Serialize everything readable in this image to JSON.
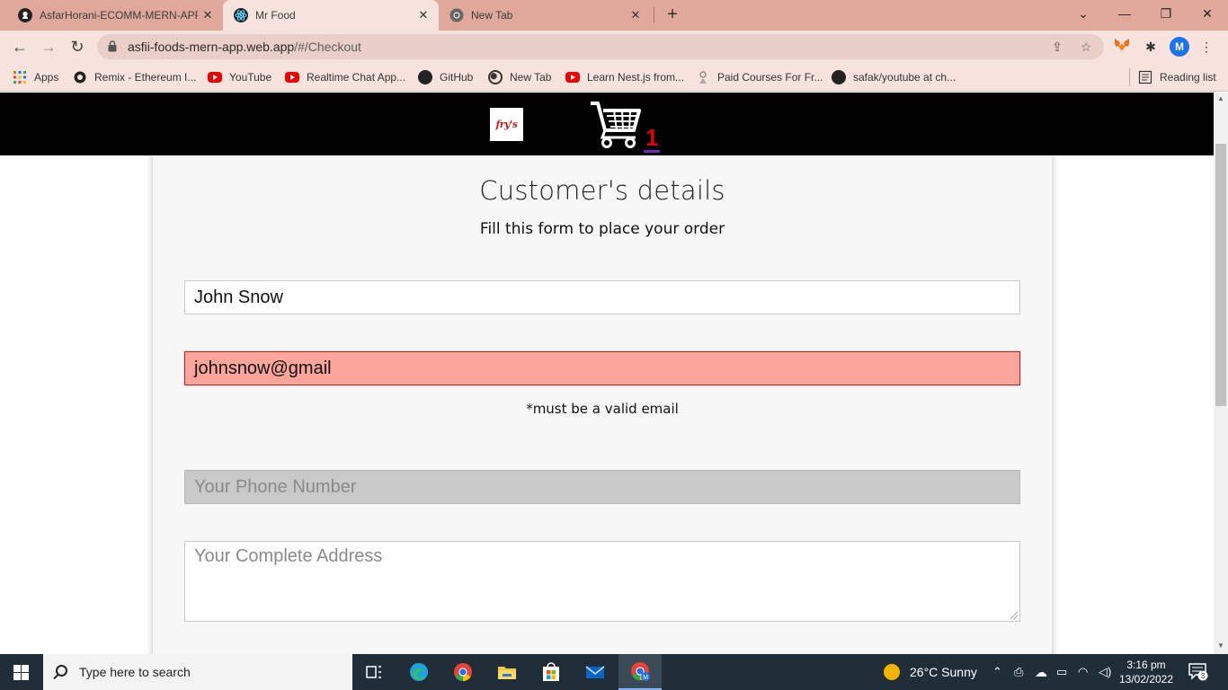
{
  "browser": {
    "tabs": [
      {
        "title": "AsfarHorani-ECOMM-MERN-APP",
        "icon": "github-icon",
        "active": false
      },
      {
        "title": "Mr Food",
        "icon": "react-icon",
        "active": true
      },
      {
        "title": "New Tab",
        "icon": "chrome-icon",
        "active": false
      }
    ],
    "url_host": "asfii-foods-mern-app.web.app",
    "url_path": "/#/Checkout",
    "profile_initial": "M",
    "bookmarks": [
      {
        "label": "Apps",
        "icon": "apps-grid-icon"
      },
      {
        "label": "Remix - Ethereum I...",
        "icon": "remix-icon"
      },
      {
        "label": "YouTube",
        "icon": "youtube-icon"
      },
      {
        "label": "Realtime Chat App...",
        "icon": "youtube-icon"
      },
      {
        "label": "GitHub",
        "icon": "github-icon"
      },
      {
        "label": "New Tab",
        "icon": "globe-icon"
      },
      {
        "label": "Learn Nest.js from...",
        "icon": "youtube-icon"
      },
      {
        "label": "Paid Courses For Fr...",
        "icon": "course-icon"
      },
      {
        "label": "safak/youtube at ch...",
        "icon": "github-icon"
      }
    ],
    "reading_list": "Reading list"
  },
  "site": {
    "logo_text": "fry's",
    "cart_count": "1"
  },
  "form": {
    "title": "Customer's details",
    "subtitle": "Fill this form to place your order",
    "name_value": "John Snow",
    "email_value": "johnsnow@gmail",
    "email_error": "*must be a valid email",
    "phone_placeholder": "Your Phone Number",
    "address_placeholder": "Your Complete Address"
  },
  "taskbar": {
    "search_placeholder": "Type here to search",
    "weather": "26°C  Sunny",
    "time": "3:16 pm",
    "date": "13/02/2022",
    "notification_count": "3"
  },
  "colors": {
    "tab_strip": "#dfa89a",
    "toolbar": "#f6e3de",
    "header": "#000000",
    "invalid_field": "#f9a59a",
    "cart_count": "#e00000",
    "taskbar": "#202e3a"
  }
}
